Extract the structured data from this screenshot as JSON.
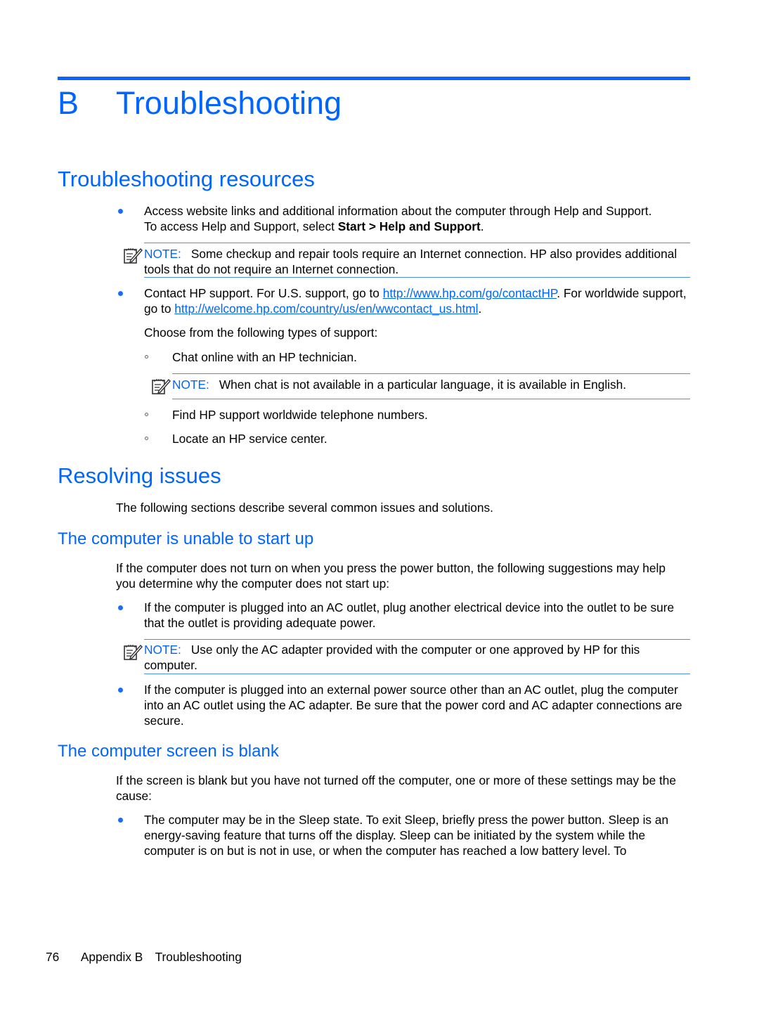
{
  "chapter": {
    "letter": "B",
    "title": "Troubleshooting"
  },
  "sections": {
    "resources": {
      "heading": "Troubleshooting resources",
      "bullet1": {
        "line1": "Access website links and additional information about the computer through Help and Support.",
        "line2_pre": "To access Help and Support, select ",
        "line2_bold": "Start > Help and Support",
        "line2_post": "."
      },
      "note1": {
        "label": "NOTE:",
        "text": "Some checkup and repair tools require an Internet connection. HP also provides additional tools that do not require an Internet connection."
      },
      "bullet2": {
        "pre": "Contact HP support. For U.S. support, go to ",
        "link1": "http://www.hp.com/go/contactHP",
        "mid": ". For worldwide support, go to ",
        "link2": "http://welcome.hp.com/country/us/en/wwcontact_us.html",
        "post": "."
      },
      "choose_text": "Choose from the following types of support:",
      "sub_items": [
        "Chat online with an HP technician.",
        "Find HP support worldwide telephone numbers.",
        "Locate an HP service center."
      ],
      "note2": {
        "label": "NOTE:",
        "text": "When chat is not available in a particular language, it is available in English."
      }
    },
    "resolving": {
      "heading": "Resolving issues",
      "intro": "The following sections describe several common issues and solutions."
    },
    "startup": {
      "heading": "The computer is unable to start up",
      "intro": "If the computer does not turn on when you press the power button, the following suggestions may help you determine why the computer does not start up:",
      "bullet1": "If the computer is plugged into an AC outlet, plug another electrical device into the outlet to be sure that the outlet is providing adequate power.",
      "note": {
        "label": "NOTE:",
        "text": "Use only the AC adapter provided with the computer or one approved by HP for this computer."
      },
      "bullet2": "If the computer is plugged into an external power source other than an AC outlet, plug the computer into an AC outlet using the AC adapter. Be sure that the power cord and AC adapter connections are secure."
    },
    "blank": {
      "heading": "The computer screen is blank",
      "intro": "If the screen is blank but you have not turned off the computer, one or more of these settings may be the cause:",
      "bullet1": "The computer may be in the Sleep state. To exit Sleep, briefly press the power button. Sleep is an energy-saving feature that turns off the display. Sleep can be initiated by the system while the computer is on but is not in use, or when the computer has reached a low battery level. To"
    }
  },
  "footer": {
    "page_number": "76",
    "appendix": "Appendix B",
    "title": "Troubleshooting"
  }
}
